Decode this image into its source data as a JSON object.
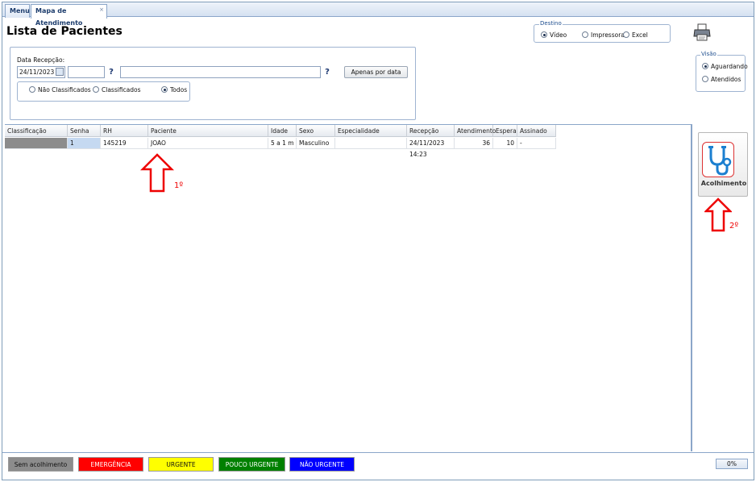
{
  "tabs": [
    {
      "label": "Menu"
    },
    {
      "label": "Mapa de Atendimento",
      "close": "×"
    }
  ],
  "page_title": "Lista de Pacientes",
  "destino": {
    "legend": "Destino",
    "options": [
      {
        "label": "Vídeo",
        "selected": true
      },
      {
        "label": "Impressora",
        "selected": false
      },
      {
        "label": "Excel",
        "selected": false
      }
    ]
  },
  "visao": {
    "legend": "Visão",
    "options": [
      {
        "label": "Aguardando",
        "selected": true
      },
      {
        "label": "Atendidos",
        "selected": false
      }
    ]
  },
  "filters": {
    "date_label": "Data Recepção:",
    "date_value": "24/11/2023",
    "help1": "?",
    "help2": "?",
    "apenas_button": "Apenas por data",
    "classification_options": [
      {
        "label": "Não Classificados",
        "selected": false
      },
      {
        "label": "Classificados",
        "selected": false
      },
      {
        "label": "Todos",
        "selected": true
      }
    ]
  },
  "table": {
    "headers": [
      "Classificação",
      "Senha",
      "RH",
      "Paciente",
      "Idade",
      "Sexo",
      "Especialidade",
      "Recepção",
      "Atendimento",
      "Espera",
      "Assinado"
    ],
    "rows": [
      {
        "classificacao": "",
        "senha": "1",
        "rh": "145219",
        "paciente": "JOAO",
        "idade": "5 a 1 m",
        "sexo": "Masculino",
        "especialidade": "",
        "recepcao": "24/11/2023 14:23",
        "atendimento": "36",
        "espera": "10",
        "assinado": "-"
      }
    ]
  },
  "side_button": {
    "label": "Acolhimento",
    "icon": "stethoscope-icon"
  },
  "annotations": {
    "first": "1º",
    "second": "2º"
  },
  "legend_bar": [
    {
      "label": "Sem acolhimento",
      "bg": "#8c8c8c",
      "fg": "#111111"
    },
    {
      "label": "EMERGÊNCIA",
      "bg": "#ff0000",
      "fg": "#ffffff"
    },
    {
      "label": "URGENTE",
      "bg": "#ffff00",
      "fg": "#111111"
    },
    {
      "label": "POUCO URGENTE",
      "bg": "#008000",
      "fg": "#ffffff"
    },
    {
      "label": "NÃO URGENTE",
      "bg": "#0000ff",
      "fg": "#ffffff"
    }
  ],
  "progress": "0%",
  "colors": {
    "accent": "#1f4f8f",
    "annotation": "#e00000"
  }
}
